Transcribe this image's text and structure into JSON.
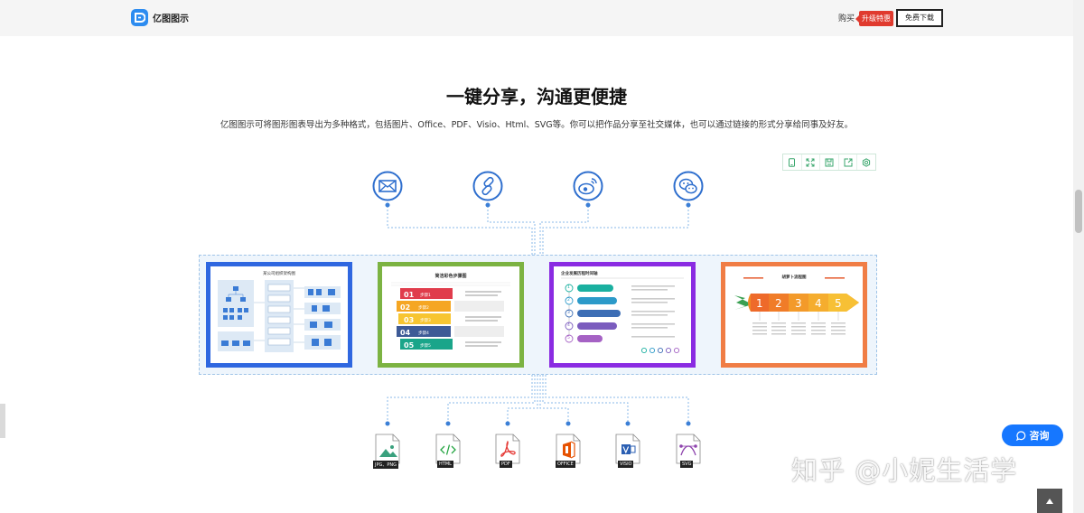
{
  "header": {
    "logo_text": "亿图图示",
    "buy_label": "购买",
    "upgrade_badge": "升级特惠",
    "download_label": "免费下载"
  },
  "main": {
    "title": "一键分享，沟通更便捷",
    "description": "亿图图示可将图形图表导出为多种格式，包括图片、Office、PDF、Visio、Html、SVG等。你可以把作品分享至社交媒体，也可以通过链接的形式分享给同事及好友。"
  },
  "toolbar": {
    "icons": [
      "phone-icon",
      "fullscreen-icon",
      "save-icon",
      "share-icon",
      "settings-icon"
    ]
  },
  "share_icons": [
    "mail-icon",
    "link-icon",
    "weibo-icon",
    "wechat-icon"
  ],
  "cards": {
    "org": {
      "title": "某公司组织架构图"
    },
    "steps": {
      "title": "简洁彩色步骤图",
      "items": [
        {
          "num": "01",
          "label": "步骤1"
        },
        {
          "num": "02",
          "label": "步骤2"
        },
        {
          "num": "03",
          "label": "步骤3"
        },
        {
          "num": "04",
          "label": "步骤4"
        },
        {
          "num": "05",
          "label": "步骤5"
        }
      ]
    },
    "timeline": {
      "title": "企业发展历程时间轴",
      "items": [
        "1",
        "2",
        "3",
        "4",
        "5"
      ]
    },
    "carrot": {
      "title": "胡萝卜流程图",
      "items": [
        "1",
        "2",
        "3",
        "4",
        "5"
      ]
    }
  },
  "formats": [
    {
      "name": "jpg-png",
      "label": "JPG、PNG",
      "color": "#3aa17e"
    },
    {
      "name": "html",
      "label": "HTML",
      "color": "#28a745"
    },
    {
      "name": "pdf",
      "label": "PDF",
      "color": "#e53935"
    },
    {
      "name": "office",
      "label": "OFFICE",
      "color": "#e65100"
    },
    {
      "name": "visio",
      "label": "VISIO",
      "color": "#2b5fb3"
    },
    {
      "name": "svg",
      "label": "SVG",
      "color": "#8e44ad"
    }
  ],
  "consult_label": "咨询",
  "watermark": "知乎 @小妮生活学",
  "colors": {
    "accent": "#2d8cf0",
    "badge": "#e03a2e",
    "consult": "#1677ff"
  }
}
